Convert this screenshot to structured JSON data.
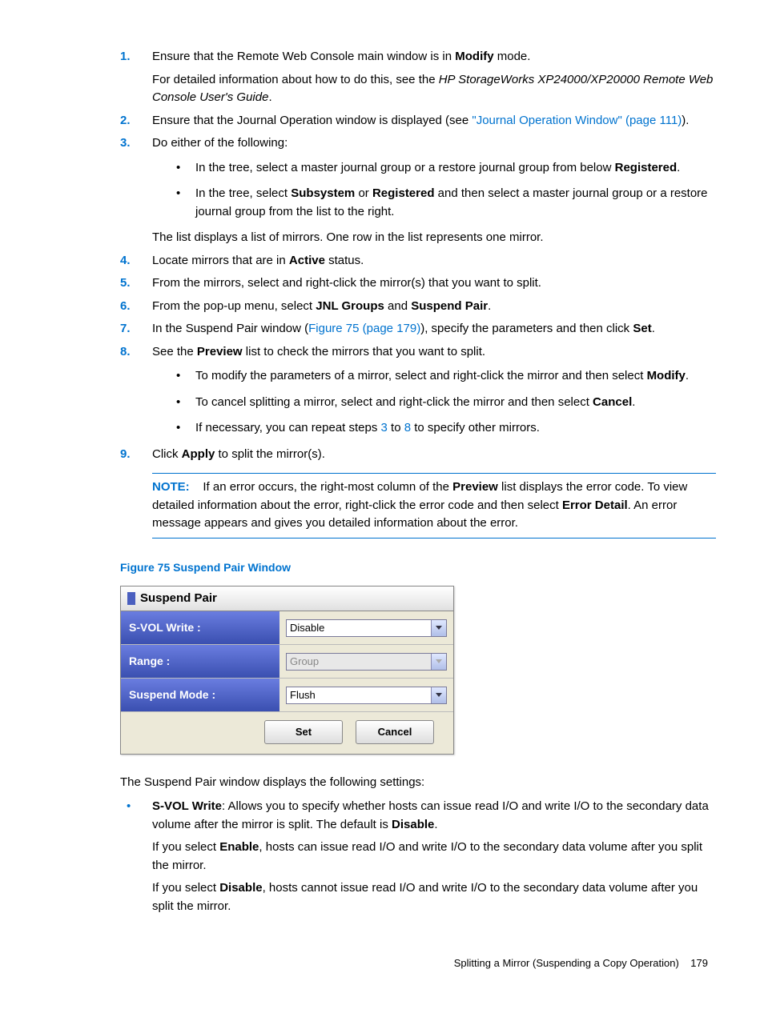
{
  "steps": {
    "s1_a": "Ensure that the Remote Web Console main window is in ",
    "s1_b": "Modify",
    "s1_c": " mode.",
    "s1_2a": "For detailed information about how to do this, see the ",
    "s1_2b": "HP StorageWorks XP24000/XP20000 Remote Web Console User's Guide",
    "s1_2c": ".",
    "s2_a": "Ensure that the Journal Operation window is displayed (see ",
    "s2_b": "\"Journal Operation Window\" (page 111)",
    "s2_c": ").",
    "s3": "Do either of the following:",
    "s3_b1a": "In the tree, select a master journal group or a restore journal group from below ",
    "s3_b1b": "Registered",
    "s3_b1c": ".",
    "s3_b2a": "In the tree, select ",
    "s3_b2b": "Subsystem",
    "s3_b2c": " or ",
    "s3_b2d": "Registered",
    "s3_b2e": " and then select a master journal group or a restore journal group from the list to the right.",
    "s3_after": "The list displays a list of mirrors. One row in the list represents one mirror.",
    "s4_a": "Locate mirrors that are in ",
    "s4_b": "Active",
    "s4_c": " status.",
    "s5": "From the mirrors, select and right-click the mirror(s) that you want to split.",
    "s6_a": "From the pop-up menu, select ",
    "s6_b": "JNL Groups",
    "s6_c": " and ",
    "s6_d": "Suspend Pair",
    "s6_e": ".",
    "s7_a": "In the Suspend Pair window (",
    "s7_b": "Figure 75 (page 179)",
    "s7_c": "), specify the parameters and then click ",
    "s7_d": "Set",
    "s7_e": ".",
    "s8_a": "See the ",
    "s8_b": "Preview",
    "s8_c": " list to check the mirrors that you want to split.",
    "s8_b1a": "To modify the parameters of a mirror, select and right-click the mirror and then select ",
    "s8_b1b": "Modify",
    "s8_b1c": ".",
    "s8_b2a": "To cancel splitting a mirror, select and right-click the mirror and then select ",
    "s8_b2b": "Cancel",
    "s8_b2c": ".",
    "s8_b3a": "If necessary, you can repeat steps ",
    "s8_b3b": "3",
    "s8_b3c": " to ",
    "s8_b3d": "8",
    "s8_b3e": " to specify other mirrors.",
    "s9_a": "Click ",
    "s9_b": "Apply",
    "s9_c": " to split the mirror(s).",
    "note_label": "NOTE:",
    "note_a": "If an error occurs, the right-most column of the ",
    "note_b": "Preview",
    "note_c": " list displays the error code. To view detailed information about the error, right-click the error code and then select ",
    "note_d": "Error Detail",
    "note_e": ". An error message appears and gives you detailed information about the error."
  },
  "nums": {
    "n1": "1.",
    "n2": "2.",
    "n3": "3.",
    "n4": "4.",
    "n5": "5.",
    "n6": "6.",
    "n7": "7.",
    "n8": "8.",
    "n9": "9."
  },
  "figure_title": "Figure 75 Suspend Pair Window",
  "dialog": {
    "title": "Suspend Pair",
    "row1_label": "S-VOL Write :",
    "row1_value": "Disable",
    "row2_label": "Range :",
    "row2_value": "Group",
    "row3_label": "Suspend Mode :",
    "row3_value": "Flush",
    "set": "Set",
    "cancel": "Cancel"
  },
  "after": {
    "intro": "The Suspend Pair window displays the following settings:",
    "svol_a": "S-VOL Write",
    "svol_b": ": Allows you to specify whether hosts can issue read I/O and write I/O to the secondary data volume after the mirror is split. The default is ",
    "svol_c": "Disable",
    "svol_d": ".",
    "enable_a": "If you select ",
    "enable_b": "Enable",
    "enable_c": ", hosts can issue read I/O and write I/O to the secondary data volume after you split the mirror.",
    "disable_a": "If you select ",
    "disable_b": "Disable",
    "disable_c": ", hosts cannot issue read I/O and write I/O to the secondary data volume after you split the mirror."
  },
  "footer": {
    "text": "Splitting a Mirror (Suspending a Copy Operation)",
    "page": "179"
  }
}
